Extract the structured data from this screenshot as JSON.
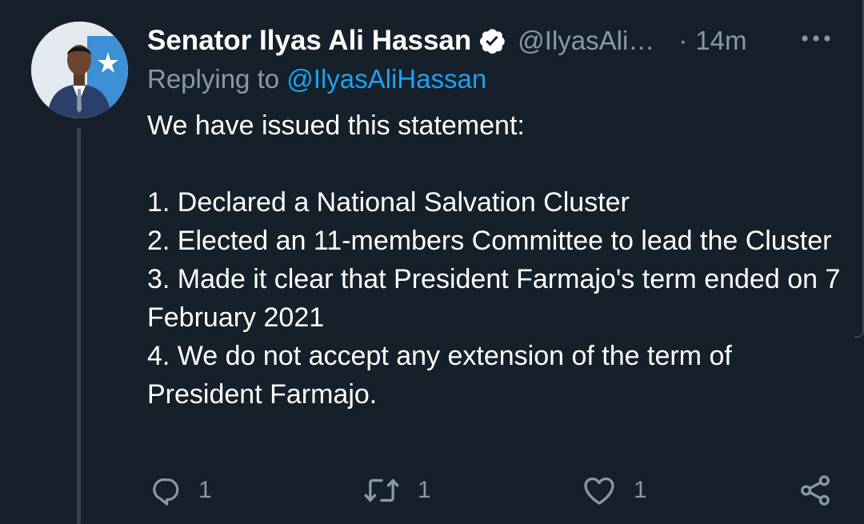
{
  "tweet": {
    "author_name": "Senator Ilyas Ali Hassan",
    "handle": "@IlyasAli…",
    "separator": "·",
    "time": "14m",
    "replying_label": "Replying to",
    "replying_to": "@IlyasAliHassan",
    "lines": [
      "We have issued this statement:",
      "",
      "1. Declared a National Salvation Cluster",
      "2. Elected an 11-members Committee to lead the Cluster",
      "3. Made it clear that President Farmajo's term ended on 7 February 2021",
      "4. We do not accept any extension of the term of President Farmajo."
    ]
  },
  "actions": {
    "reply_count": "1",
    "retweet_count": "1",
    "like_count": "1"
  },
  "icons": {
    "verified": "verified-badge-icon",
    "more": "more-options-icon",
    "reply": "reply-icon",
    "retweet": "retweet-icon",
    "like": "heart-icon",
    "share": "share-icon"
  },
  "colors": {
    "background": "#15202b",
    "text": "#ffffff",
    "muted": "#8899a6",
    "accent": "#1da1f2",
    "thread_line": "#38444d"
  }
}
